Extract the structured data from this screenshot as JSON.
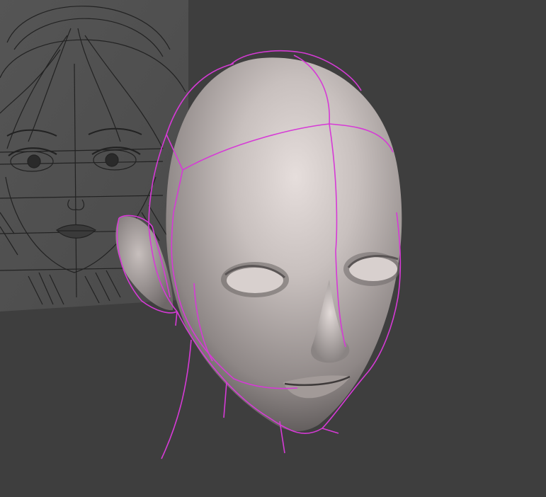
{
  "viewport": {
    "background_color": "#3e3e3e",
    "reference_image": {
      "icon": "sketch-reference-image",
      "tint": "#5a5a5a",
      "line_color": "#1e1e1e"
    },
    "model": {
      "icon": "sculpted-head-mesh",
      "surface_color": "#b8b0ae",
      "wireframe_color": "#d63ad6"
    }
  }
}
